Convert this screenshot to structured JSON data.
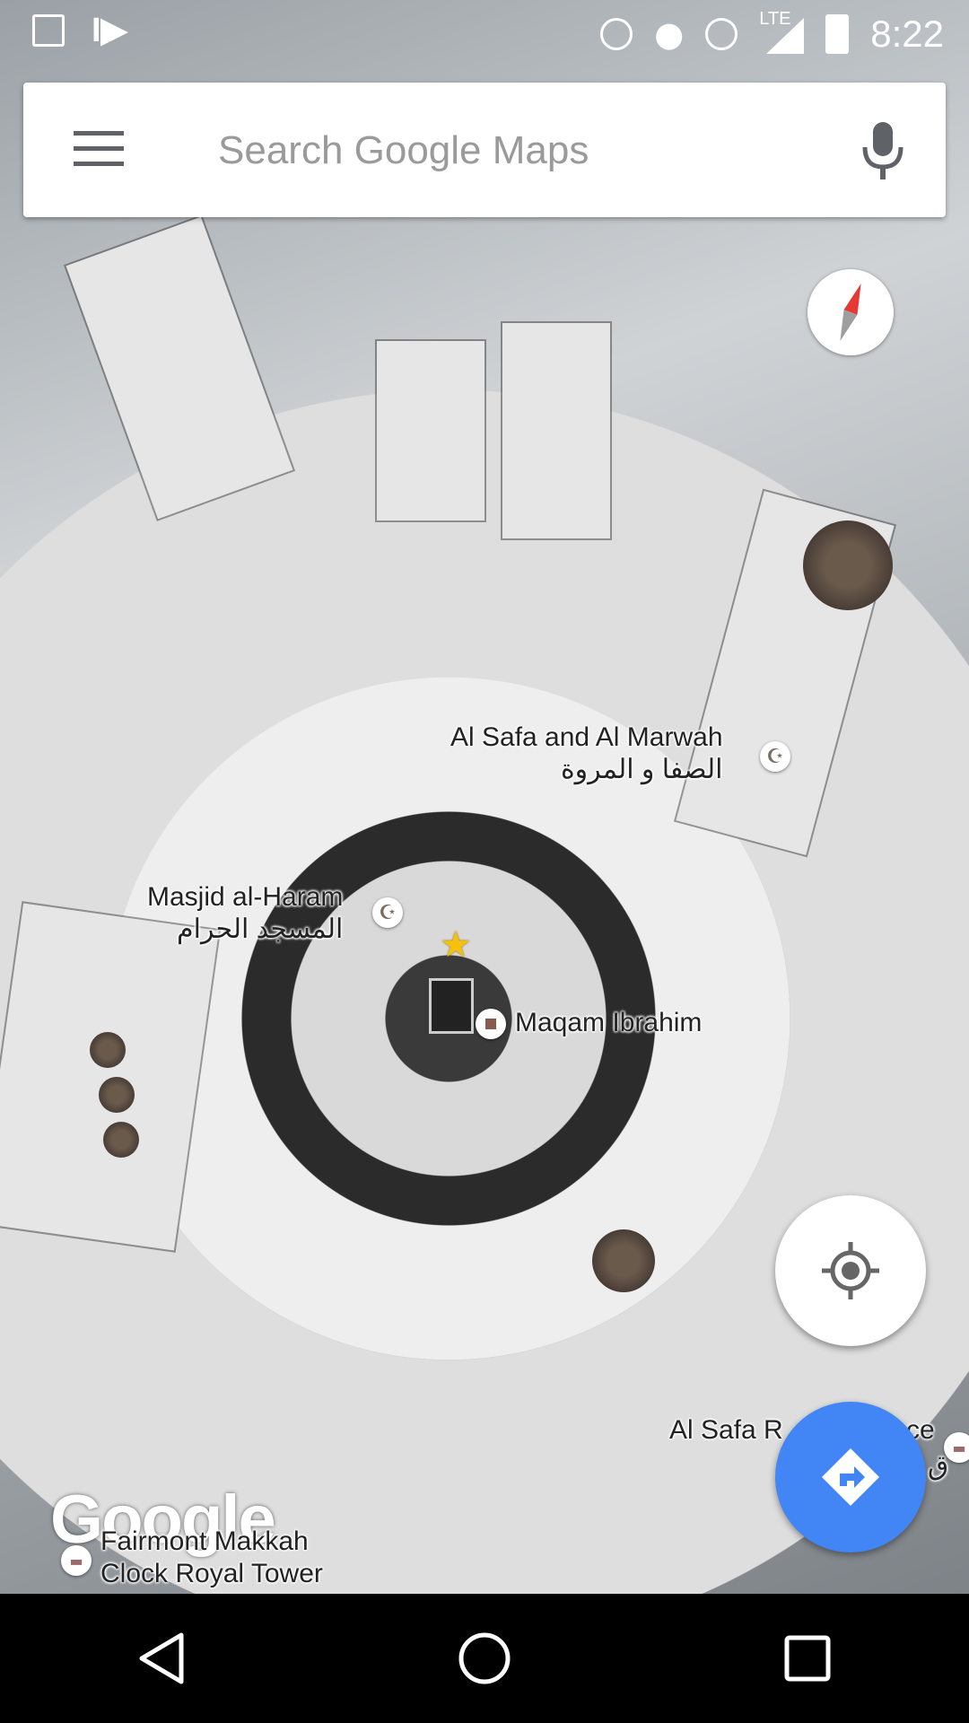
{
  "status_bar": {
    "time": "8:22",
    "network": "LTE",
    "icons": [
      "image-icon",
      "app-icon",
      "hotspot-icon",
      "location-icon",
      "alarm-icon",
      "signal-icon",
      "battery-icon"
    ]
  },
  "search": {
    "placeholder": "Search Google Maps",
    "menu_icon": "menu-icon",
    "mic_icon": "mic-icon"
  },
  "map": {
    "type": "satellite",
    "places": [
      {
        "name": "Al Safa and Al Marwah",
        "name_ar": "الصفا و المروة",
        "icon": "mosque-icon"
      },
      {
        "name": "Masjid al-Haram",
        "name_ar": "المسجد الحرام",
        "icon": "mosque-icon"
      },
      {
        "name": "Maqam Ibrahim",
        "icon": "landmark-icon"
      },
      {
        "name": "Al Safa R",
        "name_suffix": "ce",
        "name_ar": "ق",
        "icon": "hotel-icon"
      },
      {
        "name": "Fairmont Makkah Clock Royal Tower",
        "name_line1": "Fairmont Makkah",
        "name_line2": "Clock Royal Tower",
        "icon": "hotel-icon"
      }
    ],
    "logo": "Google"
  },
  "controls": {
    "compass_icon": "compass-icon",
    "locate_icon": "my-location-icon",
    "directions_icon": "directions-icon"
  },
  "navbar": {
    "back_icon": "back-icon",
    "home_icon": "home-icon",
    "recents_icon": "recents-icon"
  }
}
